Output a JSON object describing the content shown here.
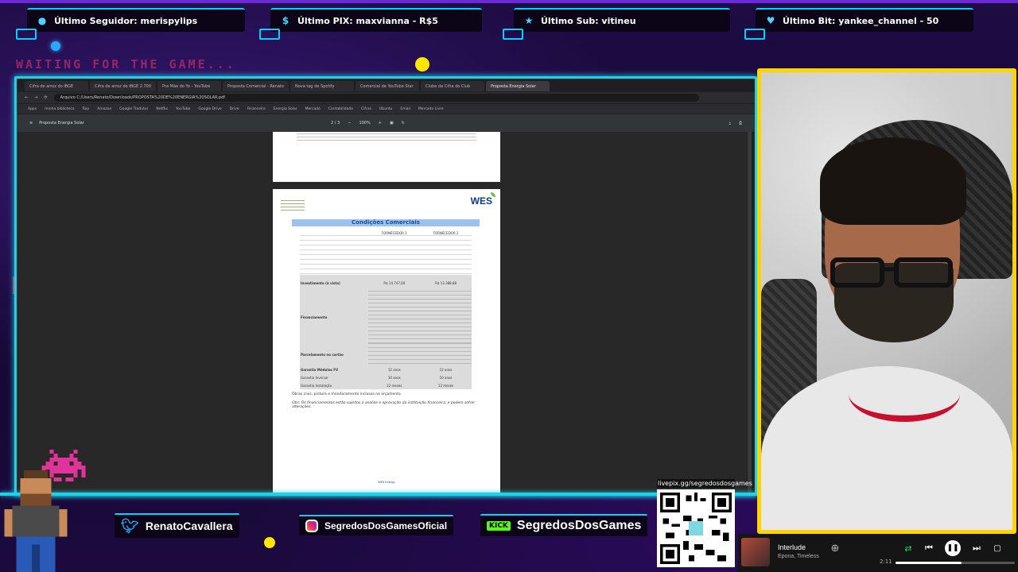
{
  "alerts": [
    {
      "icon": "user-icon",
      "label": "Último Seguidor: merispylips"
    },
    {
      "icon": "pix-icon",
      "label": "Último PIX: maxvianna - R$5"
    },
    {
      "icon": "star-icon",
      "label": "Último Sub: vitineu"
    },
    {
      "icon": "heart-icon",
      "label": "Último Bit: yankee_channel - 50"
    }
  ],
  "waiting_text": "WAITING FOR THE GAME...",
  "browser": {
    "tabs": [
      "Cifra de arroz do IBGE",
      "Cifra de arroz do IBGE 2.700",
      "Pra Mãe do Yo - YouTube",
      "Proposta Comercial - Renato",
      "Nova tag de Spotify",
      "Comercial de YouTube Star",
      "Clube da Cifra do Club",
      "Proposta Energia Solar"
    ],
    "address": "Arquivo   C:/Users/Renato/Downloads/PROPOSTA%20DE%20ENERGIA%20SOLAR.pdf",
    "bookmarks": [
      "Apps",
      "minha biblioteca",
      "Ray",
      "Amazon",
      "Google Tradutor",
      "Netflix",
      "YouTube",
      "Google Drive",
      "Drive",
      "Financeiro",
      "Energia Solar",
      "Mercado",
      "Contabilidade",
      "Cifras",
      "Ubuntu",
      "Email",
      "Mercado Livre"
    ],
    "pdf_title": "Proposta Energia Solar",
    "page_counter": "2 / 3",
    "zoom": "100%"
  },
  "pdf": {
    "logo": "WES",
    "section_title": "Condições Comerciais",
    "col_a": "FORNECEDOR 1",
    "col_b": "FORNECEDOR 2",
    "investment_label": "Investimento (à vista)",
    "investment_a": "R$ 14.747,00",
    "investment_b": "R$ 13.388,88",
    "financing_label": "Financiamento",
    "card_label": "Parcelamento no cartão",
    "warranty_label": "Garantia Módulos FV",
    "warranty_a": "12 anos",
    "warranty_b": "12 anos",
    "inverter_label": "Garantia Inversor",
    "inverter_a": "10 anos",
    "inverter_b": "10 anos",
    "install_label": "Garantia Instalação",
    "install_a": "12 meses",
    "install_b": "12 meses",
    "note1": "Obras civis, pintura e monitoramento inclusos no orçamento.",
    "note2": "Obs: Os financiamentos estão sujeitos à análise e aprovação da instituição financeira, e podem sofrer alterações.",
    "footer": "WES Energy"
  },
  "social": {
    "twitter": "RenatoCavallera",
    "instagram": "SegredosDosGamesOficial",
    "kick_badge": "KICK",
    "kick": "SegredosDosGames"
  },
  "qr_label": "livepix.gg/segredosdosgames",
  "player": {
    "song": "Interlude",
    "artist": "Epona, Timeless",
    "time": "2:11",
    "progress": 0.55
  },
  "colors": {
    "frame": "#1dd3e8",
    "webcam_border": "#ffd400",
    "accent": "#00d4ff"
  }
}
